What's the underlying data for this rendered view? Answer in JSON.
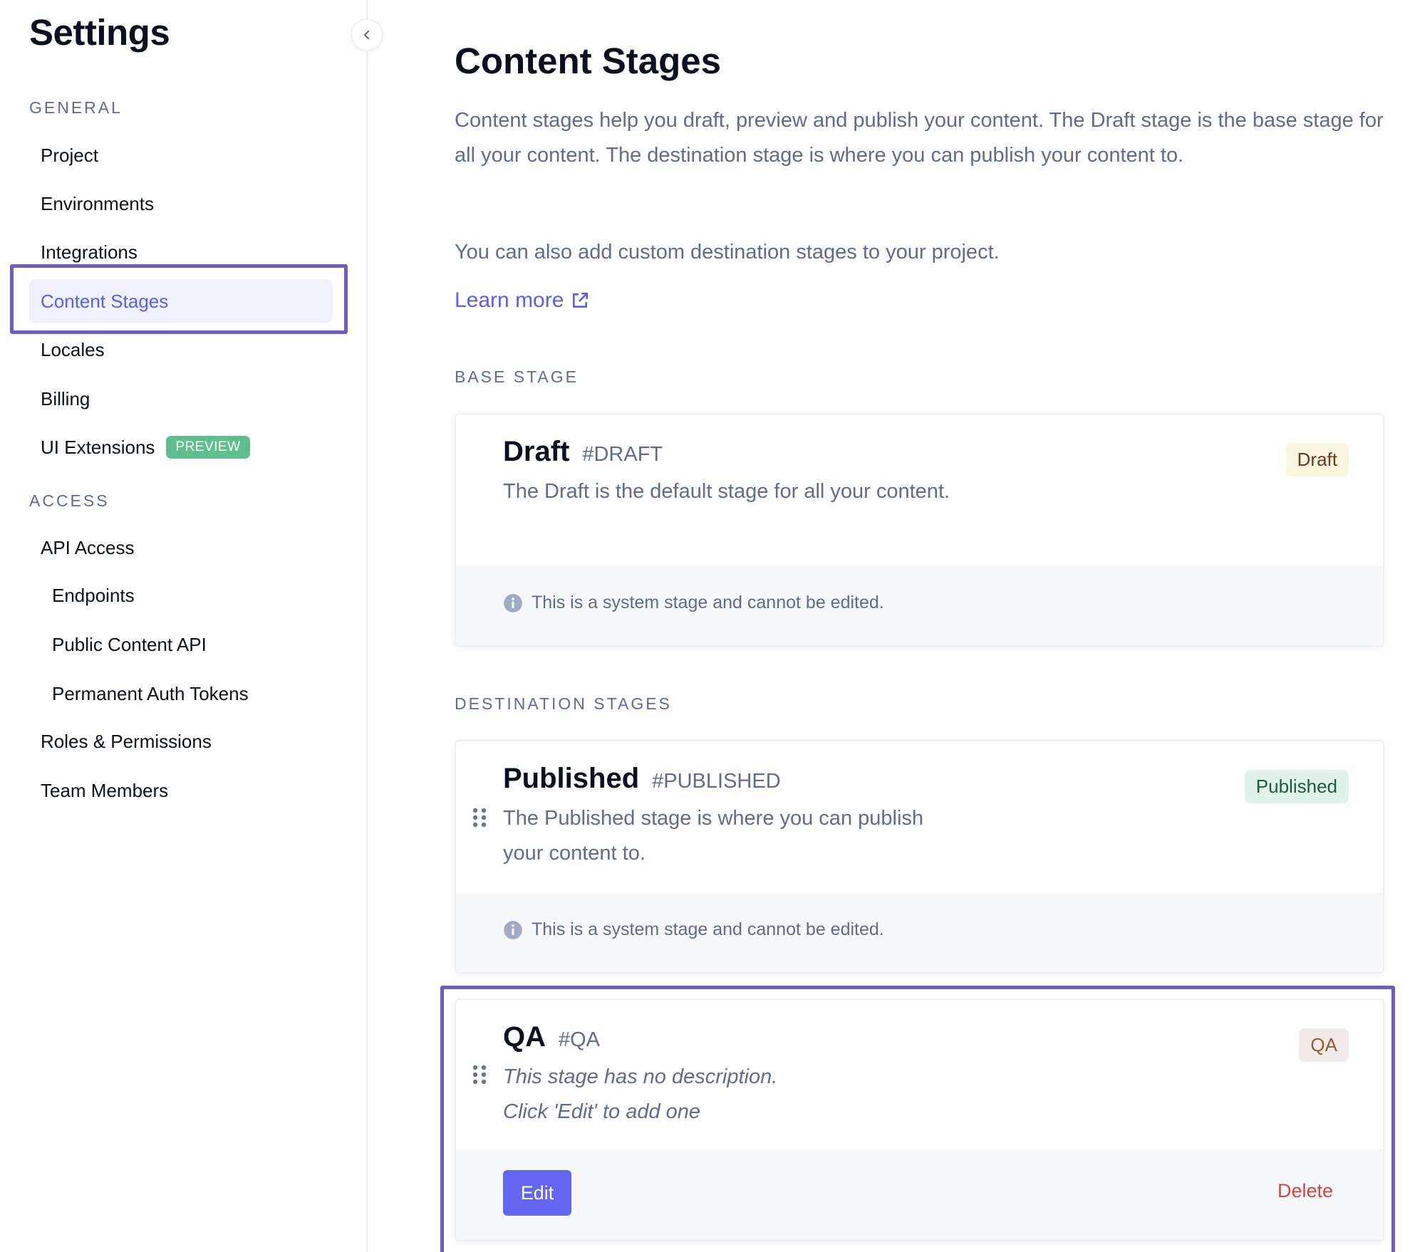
{
  "sidebar": {
    "title": "Settings",
    "collapse_icon": "chevron-left-icon",
    "sections": [
      {
        "label": "GENERAL",
        "items": [
          {
            "label": "Project"
          },
          {
            "label": "Environments"
          },
          {
            "label": "Integrations"
          },
          {
            "label": "Content Stages",
            "active": true
          },
          {
            "label": "Locales"
          },
          {
            "label": "Billing"
          },
          {
            "label": "UI Extensions",
            "badge": "PREVIEW"
          }
        ]
      },
      {
        "label": "ACCESS",
        "items": [
          {
            "label": "API Access"
          },
          {
            "label": "Endpoints",
            "sub": true
          },
          {
            "label": "Public Content API",
            "sub": true
          },
          {
            "label": "Permanent Auth Tokens",
            "sub": true
          },
          {
            "label": "Roles & Permissions"
          },
          {
            "label": "Team Members"
          }
        ]
      }
    ]
  },
  "main": {
    "title": "Content Stages",
    "intro": "Content stages help you draft, preview and publish your content. The Draft stage is the base stage for all your content. The destination stage is where you can publish your content to.",
    "intro2": "You can also add custom destination stages to your project.",
    "learn_more": "Learn more",
    "learn_more_icon": "external-link-icon",
    "base_stage_label": "BASE STAGE",
    "destination_stages_label": "DESTINATION STAGES",
    "stages": {
      "draft": {
        "name": "Draft",
        "key": "#DRAFT",
        "description": "The Draft is the default stage for all your content.",
        "badge": "Draft",
        "badge_bg": "#faf6e0",
        "badge_color": "#6b3a1e",
        "note": "This is a system stage and cannot be edited."
      },
      "published": {
        "name": "Published",
        "key": "#PUBLISHED",
        "description": "The Published stage is where you can publish your content to.",
        "badge": "Published",
        "badge_bg": "#dff3ea",
        "badge_color": "#1f5a43",
        "note": "This is a system stage and cannot be edited."
      },
      "qa": {
        "name": "QA",
        "key": "#QA",
        "description_line1": "This stage has no description.",
        "description_line2": "Click 'Edit' to add one",
        "badge": "QA",
        "badge_bg": "#f3eaea",
        "badge_color": "#9a5a2e",
        "edit_label": "Edit",
        "delete_label": "Delete"
      }
    }
  },
  "colors": {
    "accent": "#5b5ef0",
    "button": "#6366f1",
    "highlight": "#6c5ec8",
    "danger": "#d64545",
    "muted_text": "#5f6b94",
    "preview_badge": "#5fbf8f"
  }
}
